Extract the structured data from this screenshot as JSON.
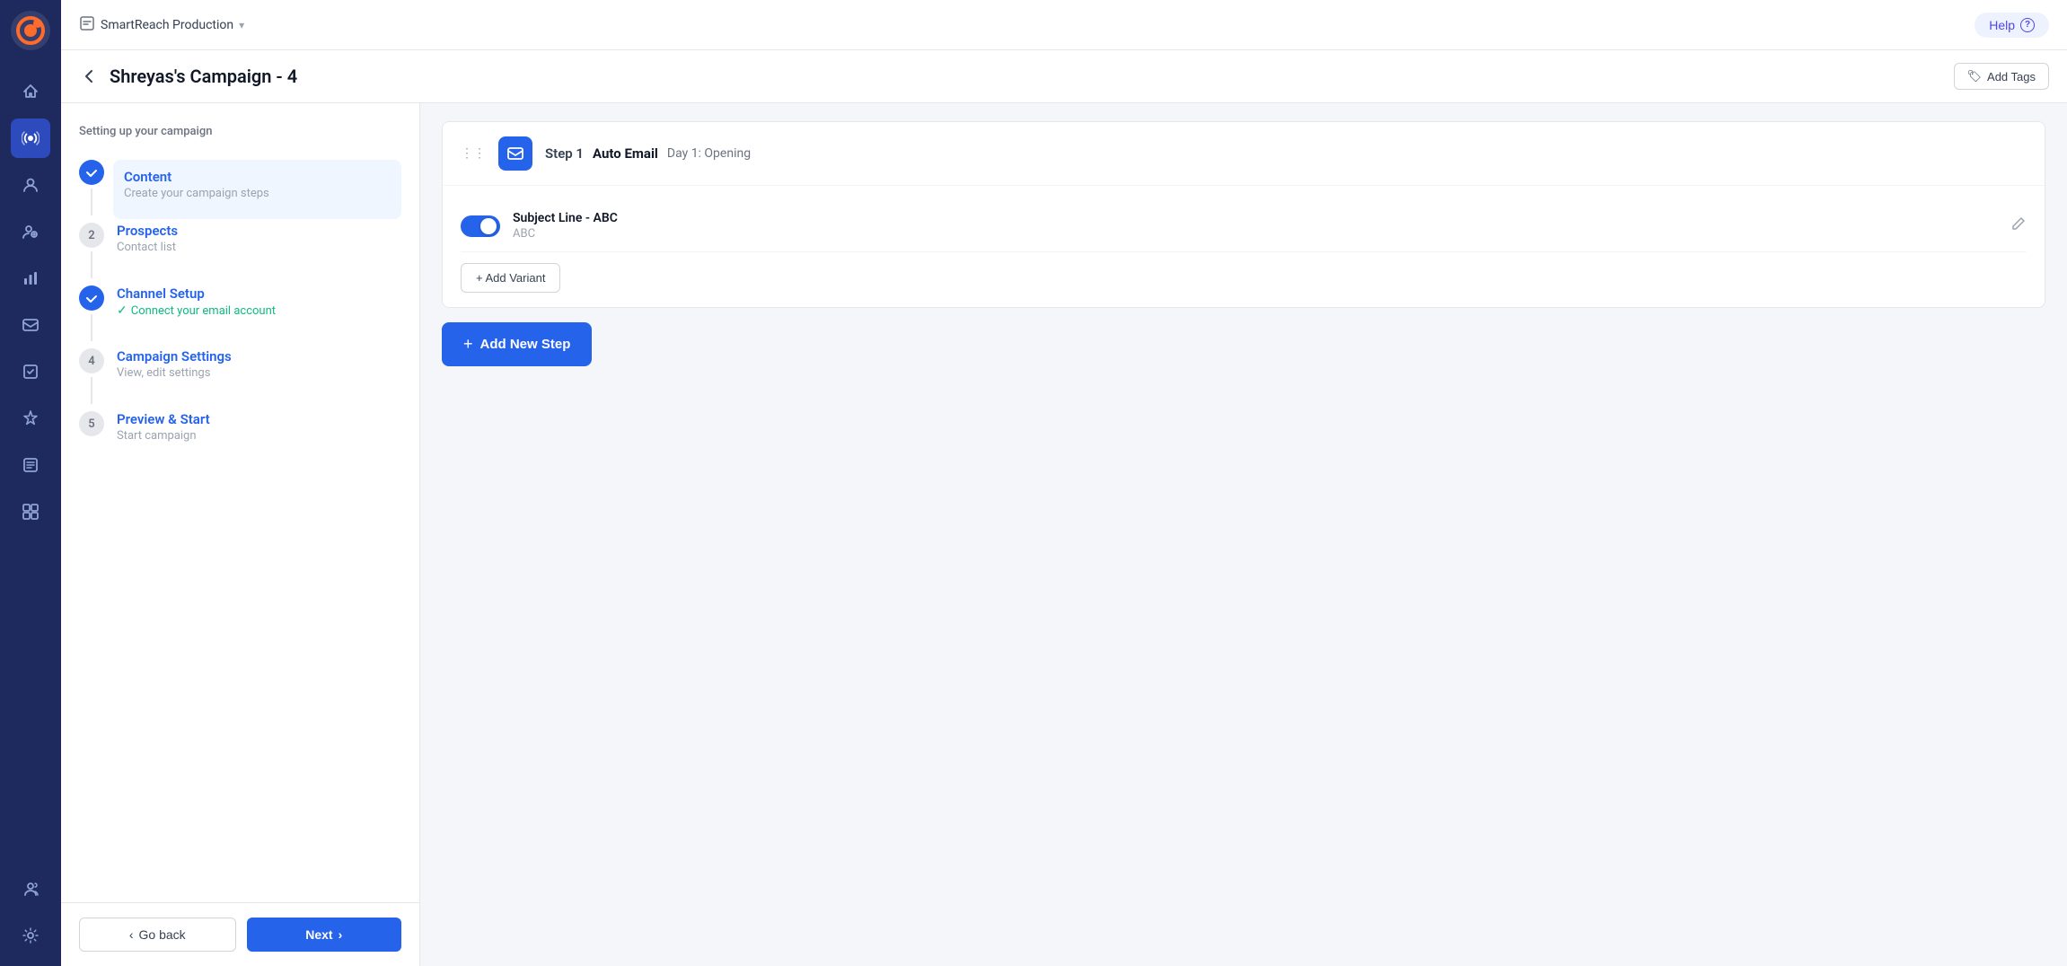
{
  "topbar": {
    "workspace_name": "SmartReach Production",
    "help_label": "Help"
  },
  "page": {
    "title": "Shreyas's Campaign - 4",
    "add_tags_label": "Add Tags",
    "setup_subtitle": "Setting up your campaign"
  },
  "sidebar_steps": [
    {
      "id": "content",
      "number": "✓",
      "completed": true,
      "active": true,
      "label": "Content",
      "sublabel": "Create your campaign steps"
    },
    {
      "id": "prospects",
      "number": "2",
      "completed": false,
      "active": false,
      "label": "Prospects",
      "sublabel": "Contact list"
    },
    {
      "id": "channel-setup",
      "number": "✓",
      "completed": true,
      "active": false,
      "label": "Channel Setup",
      "sublabel": "Connect your email account"
    },
    {
      "id": "campaign-settings",
      "number": "4",
      "completed": false,
      "active": false,
      "label": "Campaign Settings",
      "sublabel": "View, edit settings"
    },
    {
      "id": "preview-start",
      "number": "5",
      "completed": false,
      "active": false,
      "label": "Preview & Start",
      "sublabel": "Start campaign"
    }
  ],
  "footer": {
    "go_back_label": "Go back",
    "next_label": "Next"
  },
  "main_step": {
    "step_number": "Step 1",
    "step_type": "Auto Email",
    "step_day": "Day 1: Opening",
    "variant_title": "Subject Line - ABC",
    "variant_value": "ABC",
    "add_variant_label": "+ Add Variant",
    "add_step_label": "+ Add New Step"
  },
  "nav_items": [
    {
      "icon": "🚀",
      "label": "campaigns",
      "active": false
    },
    {
      "icon": "📣",
      "label": "broadcasts",
      "active": true
    },
    {
      "icon": "👥",
      "label": "contacts",
      "active": false
    },
    {
      "icon": "👤",
      "label": "prospects",
      "active": false
    },
    {
      "icon": "📊",
      "label": "reports",
      "active": false
    },
    {
      "icon": "✉️",
      "label": "email",
      "active": false
    },
    {
      "icon": "✅",
      "label": "tasks",
      "active": false
    },
    {
      "icon": "🏆",
      "label": "leaderboard",
      "active": false
    },
    {
      "icon": "📄",
      "label": "templates",
      "active": false
    },
    {
      "icon": "⊞",
      "label": "integrations",
      "active": false
    },
    {
      "icon": "👤",
      "label": "team",
      "active": false
    },
    {
      "icon": "⚙️",
      "label": "settings",
      "active": false
    }
  ],
  "colors": {
    "primary": "#2563eb",
    "sidebar_bg": "#1e2a5e"
  }
}
